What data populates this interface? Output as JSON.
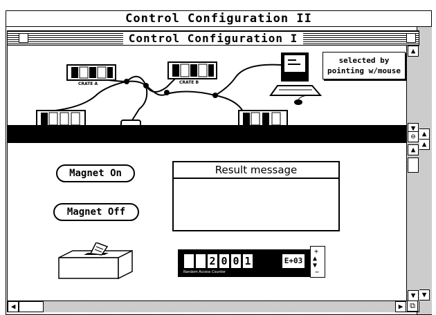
{
  "window_back": {
    "title": "Control Configuration II"
  },
  "window_front": {
    "title": "Control Configuration I"
  },
  "diagram": {
    "crate_a_label": "CRATE A",
    "crate_b_label": "CRATE B",
    "callout_line1": "selected by",
    "callout_line2": "pointing w/mouse"
  },
  "buttons": {
    "magnet_on": "Magnet On",
    "magnet_off": "Magnet Off"
  },
  "result": {
    "title": "Result message",
    "text": ""
  },
  "counter": {
    "digits": [
      "",
      "",
      "2",
      "0",
      "0",
      "1"
    ],
    "exponent": "E+03",
    "caption": "Random Access Counter"
  },
  "icons": {
    "ballot_box": "ballot-box-icon",
    "computer": "computer-icon",
    "stepper_up": "triangle-up-icon",
    "stepper_down": "triangle-down-icon"
  }
}
